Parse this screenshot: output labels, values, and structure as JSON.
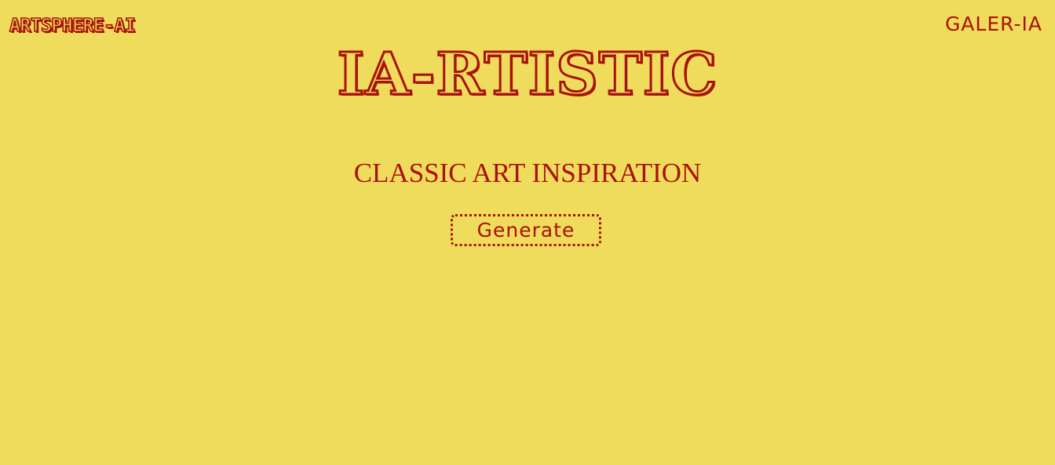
{
  "header": {
    "brand": "ARTSPHERE-AI",
    "nav_link": "GALER-IA"
  },
  "hero": {
    "title": "IA-RTISTIC",
    "subtitle": "CLASSIC ART INSPIRATION",
    "button_label": "Generate"
  },
  "colors": {
    "background": "#f0dc5c",
    "accent": "#a8120c"
  }
}
